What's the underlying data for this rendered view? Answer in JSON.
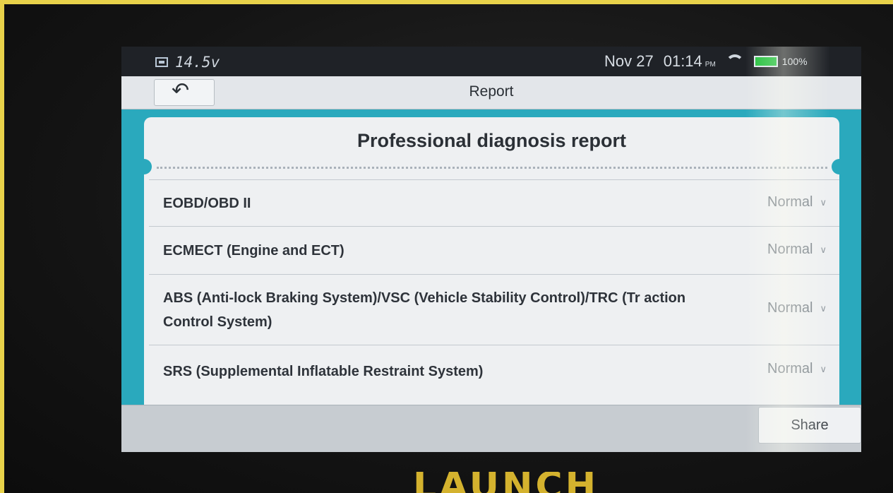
{
  "status_bar": {
    "voltage": "14.5v",
    "date": "Nov 27",
    "time": "01:14",
    "ampm": "PM",
    "battery": "100%"
  },
  "header": {
    "title": "Report",
    "back_icon": "back-arrow-icon"
  },
  "report": {
    "title": "Professional diagnosis report",
    "rows": [
      {
        "name": "EOBD/OBD II",
        "status": "Normal"
      },
      {
        "name": "ECMECT (Engine and ECT)",
        "status": "Normal"
      },
      {
        "name": "ABS (Anti-lock Braking System)/VSC (Vehicle Stability Control)/TRC (Tr action Control System)",
        "status": "Normal"
      },
      {
        "name": "SRS (Supplemental Inflatable Restraint System)",
        "status": "Normal"
      }
    ]
  },
  "footer": {
    "share_label": "Share"
  },
  "device": {
    "brand": "LAUNCH"
  },
  "colors": {
    "accent": "#2aa9bd",
    "battery": "#1fbf3a"
  }
}
